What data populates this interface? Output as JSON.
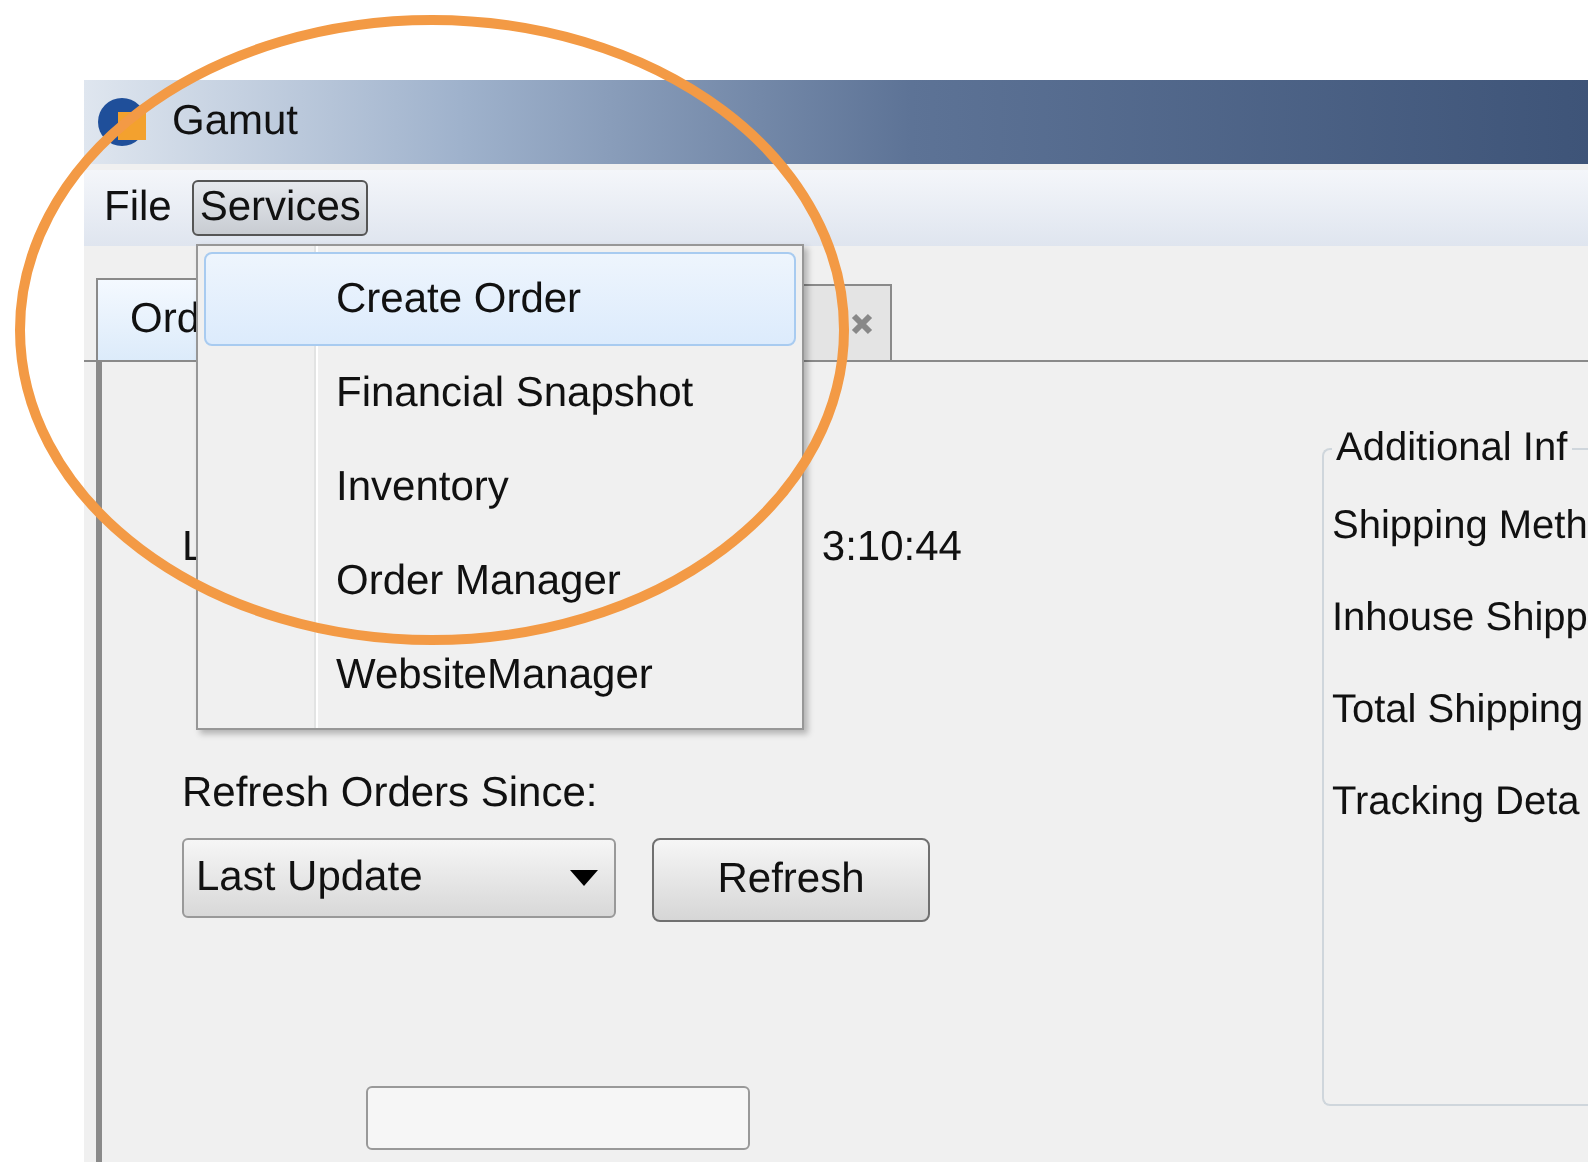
{
  "window": {
    "title": "Gamut"
  },
  "menu_bar": [
    {
      "label": "File",
      "selected": false
    },
    {
      "label": "Services",
      "selected": true
    }
  ],
  "services_menu": [
    {
      "label": "Create Order",
      "selected": true
    },
    {
      "label": "Financial Snapshot",
      "selected": false
    },
    {
      "label": "Inventory",
      "selected": false
    },
    {
      "label": "Order Manager",
      "selected": false
    },
    {
      "label": "WebsiteManager",
      "selected": false
    }
  ],
  "tabs": [
    {
      "label": "Ord",
      "selected": true
    },
    {
      "selected": false,
      "closable": true
    }
  ],
  "order_panel": {
    "line_1_label": "L",
    "line_1_value": "3:10:44",
    "refresh_label": "Refresh Orders Since:",
    "refresh_since": "Last Update",
    "refresh_button": "Refresh"
  },
  "additional_info": {
    "title": "Additional Inf",
    "labels": [
      "Shipping Meth",
      "Inhouse Shipp",
      "Total Shipping",
      "Tracking Deta"
    ]
  }
}
